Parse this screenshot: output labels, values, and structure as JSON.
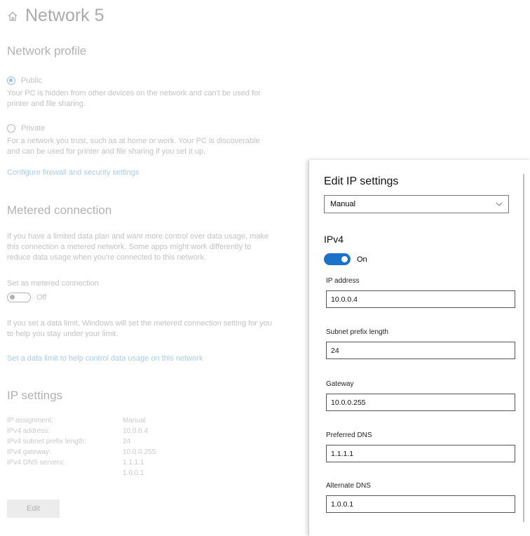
{
  "page": {
    "title": "Network 5",
    "network_profile": {
      "heading": "Network profile",
      "public_label": "Public",
      "public_desc": "Your PC is hidden from other devices on the network and can't be used for printer and file sharing.",
      "private_label": "Private",
      "private_desc": "For a network you trust, such as at home or work. Your PC is discoverable and can be used for printer and file sharing if you set it up.",
      "firewall_link": "Configure firewall and security settings"
    },
    "metered": {
      "heading": "Metered connection",
      "desc": "If you have a limited data plan and want more control over data usage, make this connection a metered network. Some apps might work differently to reduce data usage when you're connected to this network.",
      "set_label": "Set as metered connection",
      "toggle_state": "Off",
      "limit_desc": "If you set a data limit, Windows will set the metered connection setting for you to help you stay under your limit.",
      "limit_link": "Set a data limit to help control data usage on this network"
    },
    "ip_settings": {
      "heading": "IP settings",
      "rows": [
        {
          "key": "IP assignment:",
          "value": "Manual"
        },
        {
          "key": "IPv4 address:",
          "value": "10.0.0.4"
        },
        {
          "key": "IPv4 subnet prefix length:",
          "value": "24"
        },
        {
          "key": "IPv4 gateway:",
          "value": "10.0.0.255"
        },
        {
          "key": "IPv4 DNS servers:",
          "value": "1.1.1.1"
        },
        {
          "key": "",
          "value": "1.0.0.1"
        }
      ],
      "edit_button": "Edit"
    }
  },
  "dialog": {
    "title": "Edit IP settings",
    "mode_selected": "Manual",
    "ipv4_heading": "IPv4",
    "ipv4_toggle": "On",
    "fields": [
      {
        "label": "IP address",
        "value": "10.0.0.4"
      },
      {
        "label": "Subnet prefix length",
        "value": "24"
      },
      {
        "label": "Gateway",
        "value": "10.0.0.255"
      },
      {
        "label": "Preferred DNS",
        "value": "1.1.1.1"
      },
      {
        "label": "Alternate DNS",
        "value": "1.0.0.1"
      }
    ]
  },
  "colors": {
    "accent": "#1a73c8",
    "link": "#3b8fd6"
  },
  "icons": [
    "home-icon",
    "chevron-down-icon"
  ]
}
